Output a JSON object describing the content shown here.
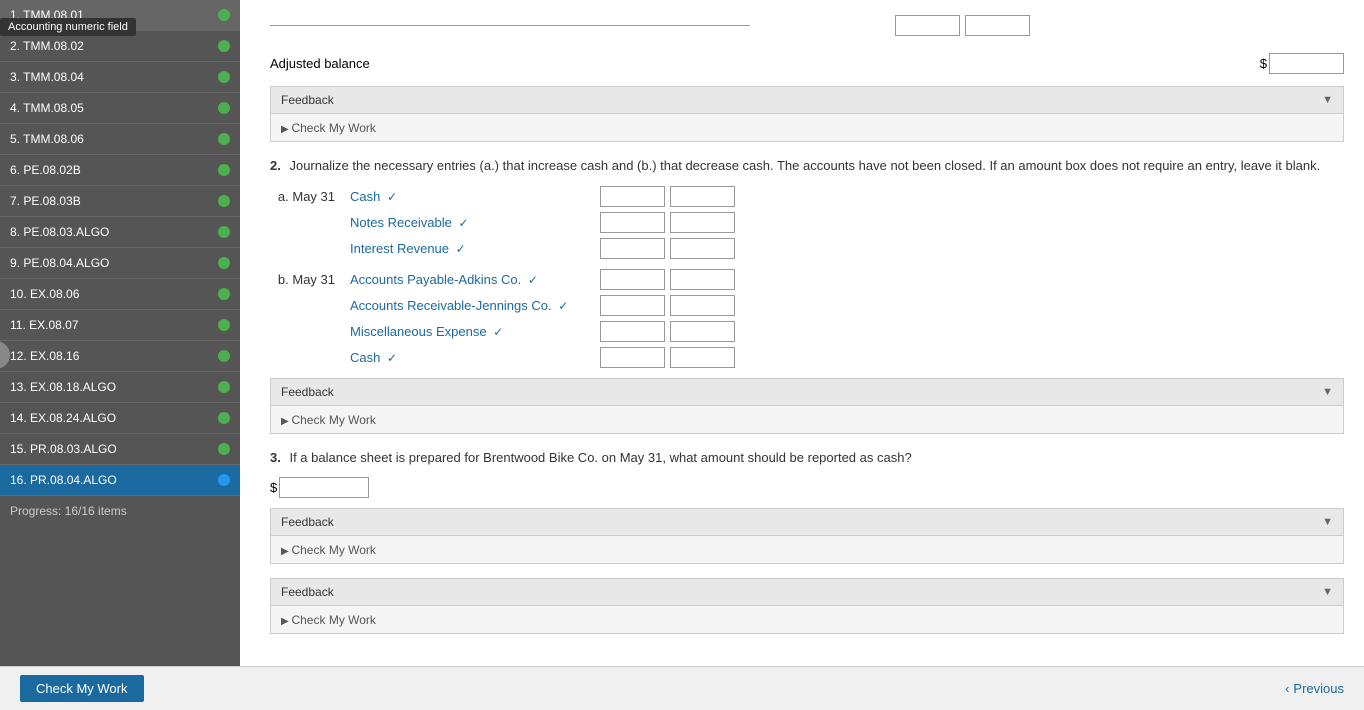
{
  "tooltip": "Accounting numeric field",
  "sidebar": {
    "items": [
      {
        "id": "TMM.08.01",
        "label": "1. TMM.08.01",
        "status": "green",
        "active": false
      },
      {
        "id": "TMM.08.02",
        "label": "2. TMM.08.02",
        "status": "green",
        "active": false
      },
      {
        "id": "TMM.08.04",
        "label": "3. TMM.08.04",
        "status": "green",
        "active": false
      },
      {
        "id": "TMM.08.05",
        "label": "4. TMM.08.05",
        "status": "green",
        "active": false
      },
      {
        "id": "TMM.08.06",
        "label": "5. TMM.08.06",
        "status": "green",
        "active": false
      },
      {
        "id": "PE.08.02B",
        "label": "6. PE.08.02B",
        "status": "green",
        "active": false
      },
      {
        "id": "PE.08.03B",
        "label": "7. PE.08.03B",
        "status": "green",
        "active": false
      },
      {
        "id": "PE.08.03.ALGO",
        "label": "8. PE.08.03.ALGO",
        "status": "green",
        "active": false
      },
      {
        "id": "PE.08.04.ALGO",
        "label": "9. PE.08.04.ALGO",
        "status": "green",
        "active": false
      },
      {
        "id": "EX.08.06",
        "label": "10. EX.08.06",
        "status": "green",
        "active": false
      },
      {
        "id": "EX.08.07",
        "label": "11. EX.08.07",
        "status": "green",
        "active": false
      },
      {
        "id": "EX.08.16",
        "label": "12. EX.08.16",
        "status": "green",
        "active": false
      },
      {
        "id": "EX.08.18.ALGO",
        "label": "13. EX.08.18.ALGO",
        "status": "green",
        "active": false
      },
      {
        "id": "EX.08.24.ALGO",
        "label": "14. EX.08.24.ALGO",
        "status": "green",
        "active": false
      },
      {
        "id": "PR.08.03.ALGO",
        "label": "15. PR.08.03.ALGO",
        "status": "green",
        "active": false
      },
      {
        "id": "PR.08.04.ALGO",
        "label": "16. PR.08.04.ALGO",
        "status": "blue",
        "active": true
      }
    ]
  },
  "adjusted_balance": {
    "label": "Adjusted balance",
    "dollar_sign": "$"
  },
  "feedback": {
    "label": "Feedback",
    "check_my_work": "Check My Work"
  },
  "question2": {
    "number": "2.",
    "text": "Journalize the necessary entries (a.) that increase cash and (b.) that decrease cash. The accounts have not been closed. If an amount box does not require an entry, leave it blank.",
    "section_a": {
      "date": "a. May 31",
      "accounts": [
        {
          "name": "Cash",
          "checkmark": "✓"
        },
        {
          "name": "Notes Receivable",
          "checkmark": "✓"
        },
        {
          "name": "Interest Revenue",
          "checkmark": "✓"
        }
      ]
    },
    "section_b": {
      "date": "b. May 31",
      "accounts": [
        {
          "name": "Accounts Payable-Adkins Co.",
          "checkmark": "✓"
        },
        {
          "name": "Accounts Receivable-Jennings Co.",
          "checkmark": "✓"
        },
        {
          "name": "Miscellaneous Expense",
          "checkmark": "✓"
        },
        {
          "name": "Cash",
          "checkmark": "✓"
        }
      ]
    }
  },
  "question3": {
    "number": "3.",
    "text": "If a balance sheet is prepared for Brentwood Bike Co. on May 31, what amount should be reported as cash?",
    "dollar_sign": "$"
  },
  "feedback2": {
    "label": "Feedback",
    "check_my_work": "Check My Work"
  },
  "feedback3": {
    "label": "Feedback",
    "check_my_work": "Check My Work"
  },
  "feedback4": {
    "label": "Feedback",
    "check_my_work": "Check My Work"
  },
  "bottom_bar": {
    "check_my_work": "Check My Work",
    "previous": "Previous",
    "progress": "Progress: 16/16 items"
  }
}
